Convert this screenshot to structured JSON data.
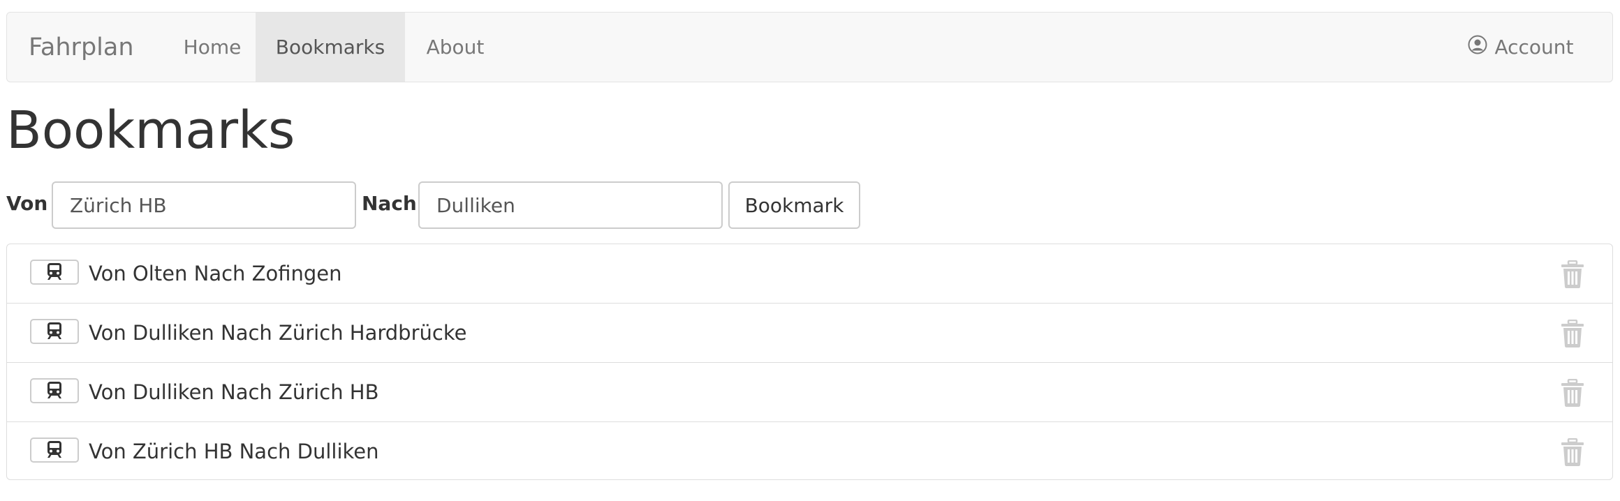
{
  "navbar": {
    "brand": "Fahrplan",
    "items": [
      {
        "label": "Home",
        "active": false
      },
      {
        "label": "Bookmarks",
        "active": true
      },
      {
        "label": "About",
        "active": false
      }
    ],
    "account_label": "Account",
    "account_icon": "user-circle-icon"
  },
  "page": {
    "title": "Bookmarks"
  },
  "form": {
    "von_label": "Von",
    "von_value": "Zürich HB",
    "nach_label": "Nach",
    "nach_value": "Dulliken",
    "submit_label": "Bookmark"
  },
  "bookmarks": [
    {
      "label": "Von Olten Nach Zofingen",
      "icon": "train-icon",
      "delete_icon": "trash-icon"
    },
    {
      "label": "Von Dulliken Nach Zürich Hardbrücke",
      "icon": "train-icon",
      "delete_icon": "trash-icon"
    },
    {
      "label": "Von Dulliken Nach Zürich HB",
      "icon": "train-icon",
      "delete_icon": "trash-icon"
    },
    {
      "label": "Von Zürich HB Nach Dulliken",
      "icon": "train-icon",
      "delete_icon": "trash-icon"
    }
  ],
  "colors": {
    "navbar_bg": "#f8f8f8",
    "active_nav_bg": "#e7e7e7",
    "border": "#dddddd",
    "text": "#333333",
    "muted_text": "#777777",
    "trash_icon": "#cccccc"
  }
}
